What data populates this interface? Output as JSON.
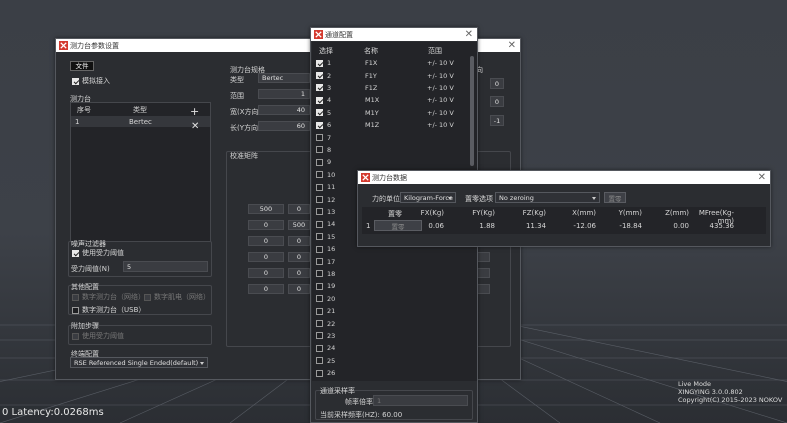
{
  "status_bar": {
    "latency": "0 Latency:0.0268ms"
  },
  "version": {
    "mode": "Live Mode",
    "product": "XINGYING 3.0.0.802",
    "copyright": "Copyright(C) 2015-2023 NOKOV"
  },
  "fp_settings": {
    "title": "测力台参数设置",
    "file_tab": "文件",
    "simulate_label": "模拟接入",
    "simulate_checked": true,
    "plates": {
      "group_label": "测力台",
      "col_no": "序号",
      "col_type": "类型",
      "rows": [
        {
          "no": "1",
          "type": "Bertec"
        }
      ]
    },
    "spec": {
      "group_label": "测力台规格",
      "type_label": "类型",
      "type_value": "Bertec",
      "range_label": "范围",
      "range_value": "1",
      "width_label": "宽(X方向)",
      "width_value": "40",
      "length_label": "长(Y方向)",
      "length_value": "60"
    },
    "right_fragment": {
      "label": "向",
      "v1": "0",
      "v2": "0",
      "v3": "-1"
    },
    "calib": {
      "group_label": "校准矩阵",
      "rows": [
        [
          "500",
          "0"
        ],
        [
          "0",
          "500"
        ],
        [
          "0",
          "0"
        ],
        [
          "0",
          "0"
        ],
        [
          "0",
          "0"
        ],
        [
          "0",
          "0"
        ]
      ]
    },
    "noise": {
      "group_label": "噪声过滤器",
      "use_threshold": "使用受力阈值",
      "use_threshold_checked": true,
      "threshold_label": "受力阈值(N)",
      "threshold_value": "5"
    },
    "other": {
      "group_label": "其他配置",
      "opt1": "数字测力台（网络）",
      "opt2": "数字肌电（网络）",
      "opt3": "数字测力台（USB）"
    },
    "extra": {
      "group_label": "附加步骤",
      "opt1": "使用受力阈值"
    },
    "terminal": {
      "group_label": "终端配置",
      "value": "RSE Referenced Single Ended(default)"
    }
  },
  "channel": {
    "title": "通道配置",
    "col_select": "选择",
    "col_name": "名称",
    "col_range": "范围",
    "rows": [
      {
        "no": "1",
        "checked": true,
        "name": "F1X",
        "range": "+/- 10 V"
      },
      {
        "no": "2",
        "checked": true,
        "name": "F1Y",
        "range": "+/- 10 V"
      },
      {
        "no": "3",
        "checked": true,
        "name": "F1Z",
        "range": "+/- 10 V"
      },
      {
        "no": "4",
        "checked": true,
        "name": "M1X",
        "range": "+/- 10 V"
      },
      {
        "no": "5",
        "checked": true,
        "name": "M1Y",
        "range": "+/- 10 V"
      },
      {
        "no": "6",
        "checked": true,
        "name": "M1Z",
        "range": "+/- 10 V"
      },
      {
        "no": "7",
        "checked": false
      },
      {
        "no": "8",
        "checked": false
      },
      {
        "no": "9",
        "checked": false
      },
      {
        "no": "10",
        "checked": false
      },
      {
        "no": "11",
        "checked": false
      },
      {
        "no": "12",
        "checked": false
      },
      {
        "no": "13",
        "checked": false
      },
      {
        "no": "14",
        "checked": false
      },
      {
        "no": "15",
        "checked": false
      },
      {
        "no": "16",
        "checked": false
      },
      {
        "no": "17",
        "checked": false
      },
      {
        "no": "18",
        "checked": false
      },
      {
        "no": "19",
        "checked": false
      },
      {
        "no": "20",
        "checked": false
      },
      {
        "no": "21",
        "checked": false
      },
      {
        "no": "22",
        "checked": false
      },
      {
        "no": "23",
        "checked": false
      },
      {
        "no": "24",
        "checked": false
      },
      {
        "no": "25",
        "checked": false
      },
      {
        "no": "26",
        "checked": false
      }
    ],
    "sampling": {
      "group_label": "通道采样率",
      "rate_label": "帧率倍率",
      "rate_value": "1",
      "current_label": "当前采样频率(HZ):",
      "current_value": "60.00"
    }
  },
  "data": {
    "title": "测力台数据",
    "unit_label": "力的单位:",
    "unit_value": "Kilogram-Force",
    "zero_label": "置零选项",
    "zero_value": "No zeroing",
    "zero_button": "置零",
    "headers": [
      "置零",
      "FX(Kg)",
      "FY(Kg)",
      "FZ(Kg)",
      "X(mm)",
      "Y(mm)",
      "Z(mm)",
      "MFree(Kg-mm)"
    ],
    "row": {
      "no": "1",
      "zero": "置零",
      "values": [
        "0.06",
        "1.88",
        "11.34",
        "-12.06",
        "-18.84",
        "0.00",
        "435.36"
      ]
    }
  }
}
